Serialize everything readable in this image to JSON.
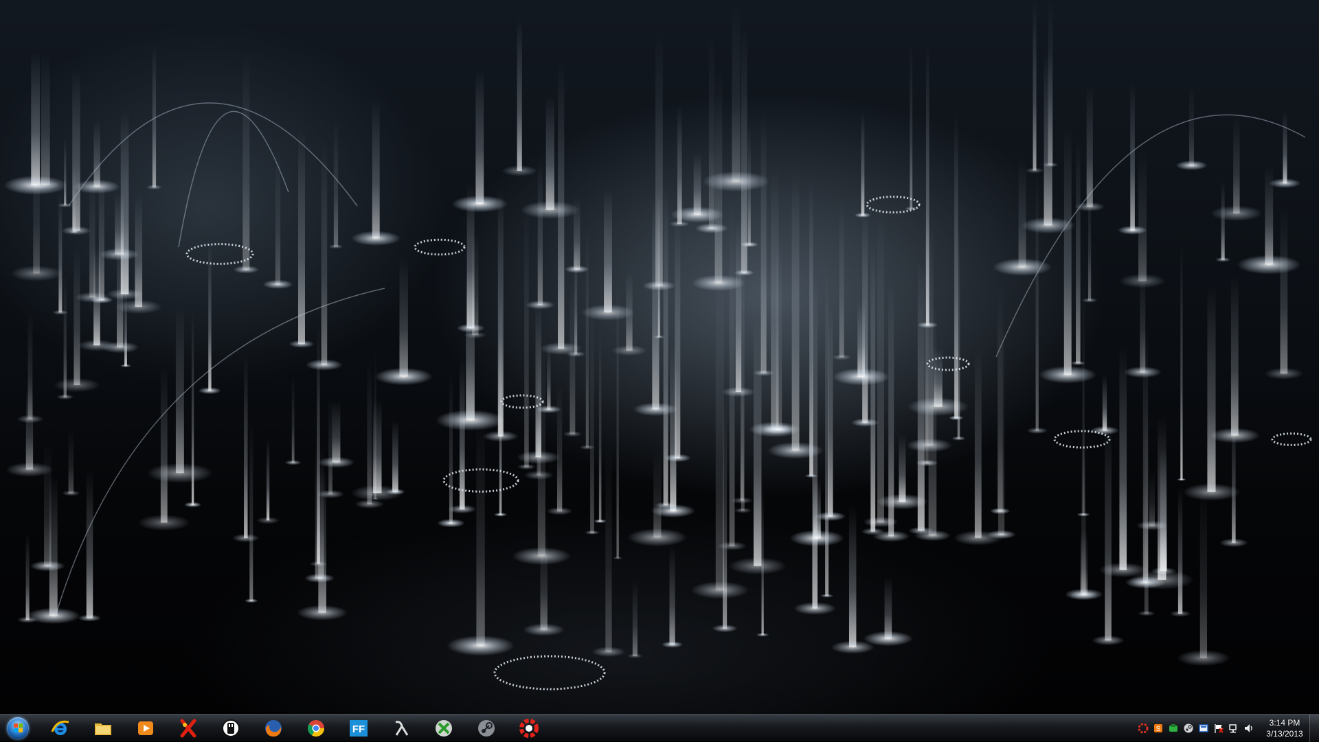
{
  "desktop": {
    "wallpaper": "abstract-light-fountains-wallpaper",
    "accent_color": "#d8e4f0",
    "background_color": "#050608"
  },
  "taskbar": {
    "start_button": {
      "icon": "windows-start-orb-icon"
    },
    "pinned": [
      {
        "name": "internet-explorer",
        "icon": "internet-explorer-icon"
      },
      {
        "name": "windows-explorer",
        "icon": "folder-icon"
      },
      {
        "name": "media-player",
        "icon": "media-player-icon"
      },
      {
        "name": "crossed-app",
        "icon": "red-x-icon"
      },
      {
        "name": "usb-tool",
        "icon": "usb-drive-icon"
      },
      {
        "name": "firefox",
        "icon": "firefox-icon"
      },
      {
        "name": "chrome",
        "icon": "chrome-icon"
      },
      {
        "name": "ff-app",
        "icon": "ff-icon",
        "label": "FF"
      },
      {
        "name": "half-life-app",
        "icon": "lambda-icon"
      },
      {
        "name": "xbox-app",
        "icon": "xbox-icon"
      },
      {
        "name": "steam",
        "icon": "steam-icon"
      },
      {
        "name": "origin-style-app",
        "icon": "red-ring-icon"
      }
    ],
    "tray": {
      "icons": [
        "red-gear-tray-icon",
        "orange-tray-icon",
        "green-tray-icon",
        "steam-tray-icon",
        "blue-tray-icon",
        "flag-tray-icon",
        "network-tray-icon",
        "volume-tray-icon"
      ],
      "time": "3:14 PM",
      "date": "3/13/2013"
    }
  }
}
